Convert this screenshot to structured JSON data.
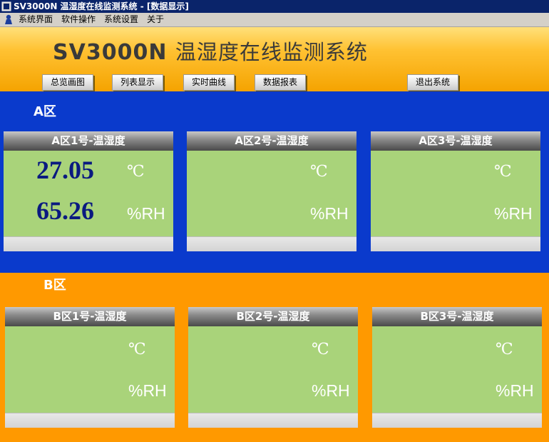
{
  "window": {
    "title": "SV3000N 温湿度在线监测系统 - [数据显示]"
  },
  "menu": {
    "items": [
      "系统界面",
      "软件操作",
      "系统设置",
      "关于"
    ]
  },
  "header": {
    "title_latin": "SV3000N",
    "title_cn": "温湿度在线监测系统"
  },
  "nav": {
    "overview": "总览画图",
    "list": "列表显示",
    "realtime": "实时曲线",
    "report": "数据报表",
    "exit": "退出系统"
  },
  "zones": [
    {
      "label": "A区",
      "cards": [
        {
          "title": "A区1号-温湿度",
          "temp": "27.05",
          "temp_unit": "℃",
          "humidity": "65.26",
          "humidity_unit": "%RH"
        },
        {
          "title": "A区2号-温湿度",
          "temp": "",
          "temp_unit": "℃",
          "humidity": "",
          "humidity_unit": "%RH"
        },
        {
          "title": "A区3号-温湿度",
          "temp": "",
          "temp_unit": "℃",
          "humidity": "",
          "humidity_unit": "%RH"
        }
      ]
    },
    {
      "label": "B区",
      "cards": [
        {
          "title": "B区1号-温湿度",
          "temp": "",
          "temp_unit": "℃",
          "humidity": "",
          "humidity_unit": "%RH"
        },
        {
          "title": "B区2号-温湿度",
          "temp": "",
          "temp_unit": "℃",
          "humidity": "",
          "humidity_unit": "%RH"
        },
        {
          "title": "B区3号-温湿度",
          "temp": "",
          "temp_unit": "℃",
          "humidity": "",
          "humidity_unit": "%RH"
        }
      ]
    }
  ],
  "colors": {
    "zone_a_bg": "#0a3acc",
    "zone_b_bg": "#ff9900",
    "card_body": "#a9d37a",
    "value_text": "#0a1a80"
  }
}
